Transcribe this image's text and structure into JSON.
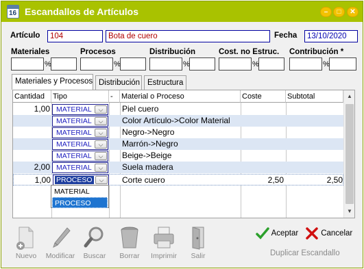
{
  "window": {
    "title": "Escandallos de Artículos",
    "icon_text": "16",
    "controls": [
      "minimize-icon",
      "maximize-icon",
      "close-icon"
    ]
  },
  "header": {
    "articulo_label": "Artículo",
    "articulo_code": "104",
    "articulo_name": "Bota de cuero",
    "fecha_label": "Fecha",
    "fecha_value": "13/10/2020"
  },
  "costs": {
    "materiales_label": "Materiales",
    "procesos_label": "Procesos",
    "distribucion_label": "Distribución",
    "cost_no_estruc_label": "Cost. no Estruc.",
    "contribucion_label": "Contribución *",
    "percent_symbol": "%"
  },
  "tabs": [
    {
      "label": "Materiales y Procesos",
      "active": true
    },
    {
      "label": "Distribución",
      "active": false
    },
    {
      "label": "Estructura",
      "active": false
    }
  ],
  "grid": {
    "columns": [
      "Cantidad",
      "Tipo",
      "-",
      "Material o Proceso",
      "Coste",
      "Subtotal"
    ],
    "rows": [
      {
        "cantidad": "1,00",
        "tipo": "MATERIAL",
        "material": "Piel cuero",
        "coste": "",
        "subtotal": ""
      },
      {
        "cantidad": "",
        "tipo": "MATERIAL",
        "material": "Color Artículo->Color Material",
        "coste": "",
        "subtotal": ""
      },
      {
        "cantidad": "",
        "tipo": "MATERIAL",
        "material": "Negro->Negro",
        "coste": "",
        "subtotal": ""
      },
      {
        "cantidad": "",
        "tipo": "MATERIAL",
        "material": "Marrón->Negro",
        "coste": "",
        "subtotal": ""
      },
      {
        "cantidad": "",
        "tipo": "MATERIAL",
        "material": "Beige->Beige",
        "coste": "",
        "subtotal": ""
      },
      {
        "cantidad": "2,00",
        "tipo": "MATERIAL",
        "material": "Suela madera",
        "coste": "",
        "subtotal": ""
      },
      {
        "cantidad": "1,00",
        "tipo": "PROCESO",
        "material": "Corte cuero",
        "coste": "2,50",
        "subtotal": "2,50"
      }
    ],
    "dropdown_options": [
      "MATERIAL",
      "PROCESO"
    ],
    "dropdown_selected": "PROCESO"
  },
  "toolbar": {
    "nuevo": "Nuevo",
    "modificar": "Modificar",
    "buscar": "Buscar",
    "borrar": "Borrar",
    "imprimir": "Imprimir",
    "salir": "Salir"
  },
  "actions": {
    "aceptar": "Aceptar",
    "cancelar": "Cancelar",
    "duplicar": "Duplicar Escandallo"
  },
  "colors": {
    "titlebar": "#a9c200",
    "row_alt": "#dce6f4",
    "accept_green": "#2ca02c",
    "cancel_red": "#d01010"
  }
}
